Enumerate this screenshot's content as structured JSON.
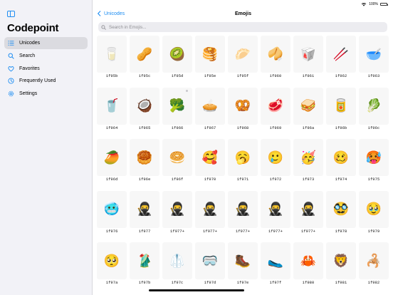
{
  "sidebar": {
    "title": "Codepoint",
    "toggle_icon": "sidebar-toggle-icon",
    "accent": "#1d8df2",
    "items": [
      {
        "label": "Unicodes",
        "icon": "list-icon",
        "active": true
      },
      {
        "label": "Search",
        "icon": "search-icon",
        "active": false
      },
      {
        "label": "Favorites",
        "icon": "heart-icon",
        "active": false
      },
      {
        "label": "Frequently Used",
        "icon": "clock-icon",
        "active": false
      },
      {
        "label": "Settings",
        "icon": "gear-icon",
        "active": false
      }
    ]
  },
  "status": {
    "battery": "100%"
  },
  "header": {
    "back_label": "Unicodes",
    "title": "Emojis"
  },
  "search": {
    "placeholder": "Search in Emojis..."
  },
  "grid": [
    {
      "code": "1f95b",
      "glyph": "🥛"
    },
    {
      "code": "1f95c",
      "glyph": "🥜"
    },
    {
      "code": "1f95d",
      "glyph": "🥝"
    },
    {
      "code": "1f95e",
      "glyph": "🥞"
    },
    {
      "code": "1f95f",
      "glyph": "🥟"
    },
    {
      "code": "1f960",
      "glyph": "🥠"
    },
    {
      "code": "1f961",
      "glyph": "🥡"
    },
    {
      "code": "1f962",
      "glyph": "🥢"
    },
    {
      "code": "1f963",
      "glyph": "🥣"
    },
    {
      "code": "1f964",
      "glyph": "🥤"
    },
    {
      "code": "1f965",
      "glyph": "🥥"
    },
    {
      "code": "1f966",
      "glyph": "🥦",
      "badge": true
    },
    {
      "code": "1f967",
      "glyph": "🥧"
    },
    {
      "code": "1f968",
      "glyph": "🥨"
    },
    {
      "code": "1f969",
      "glyph": "🥩"
    },
    {
      "code": "1f96a",
      "glyph": "🥪"
    },
    {
      "code": "1f96b",
      "glyph": "🥫"
    },
    {
      "code": "1f96c",
      "glyph": "🥬"
    },
    {
      "code": "1f96d",
      "glyph": "🥭"
    },
    {
      "code": "1f96e",
      "glyph": "🥮"
    },
    {
      "code": "1f96f",
      "glyph": "🥯"
    },
    {
      "code": "1f970",
      "glyph": "🥰"
    },
    {
      "code": "1f971",
      "glyph": "🥱"
    },
    {
      "code": "1f972",
      "glyph": "🥲"
    },
    {
      "code": "1f973",
      "glyph": "🥳"
    },
    {
      "code": "1f974",
      "glyph": "🥴"
    },
    {
      "code": "1f975",
      "glyph": "🥵"
    },
    {
      "code": "1f976",
      "glyph": "🥶"
    },
    {
      "code": "1f977",
      "glyph": "🥷"
    },
    {
      "code": "1f977+",
      "glyph": "🥷"
    },
    {
      "code": "1f977+",
      "glyph": "🥷"
    },
    {
      "code": "1f977+",
      "glyph": "🥷"
    },
    {
      "code": "1f977+",
      "glyph": "🥷"
    },
    {
      "code": "1f977+",
      "glyph": "🥷"
    },
    {
      "code": "1f978",
      "glyph": "🥸"
    },
    {
      "code": "1f979",
      "glyph": "🥹"
    },
    {
      "code": "1f97a",
      "glyph": "🥺"
    },
    {
      "code": "1f97b",
      "glyph": "🥻"
    },
    {
      "code": "1f97c",
      "glyph": "🥼"
    },
    {
      "code": "1f97d",
      "glyph": "🥽"
    },
    {
      "code": "1f97e",
      "glyph": "🥾"
    },
    {
      "code": "1f97f",
      "glyph": "🥿"
    },
    {
      "code": "1f980",
      "glyph": "🦀"
    },
    {
      "code": "1f981",
      "glyph": "🦁"
    },
    {
      "code": "1f982",
      "glyph": "🦂"
    }
  ]
}
